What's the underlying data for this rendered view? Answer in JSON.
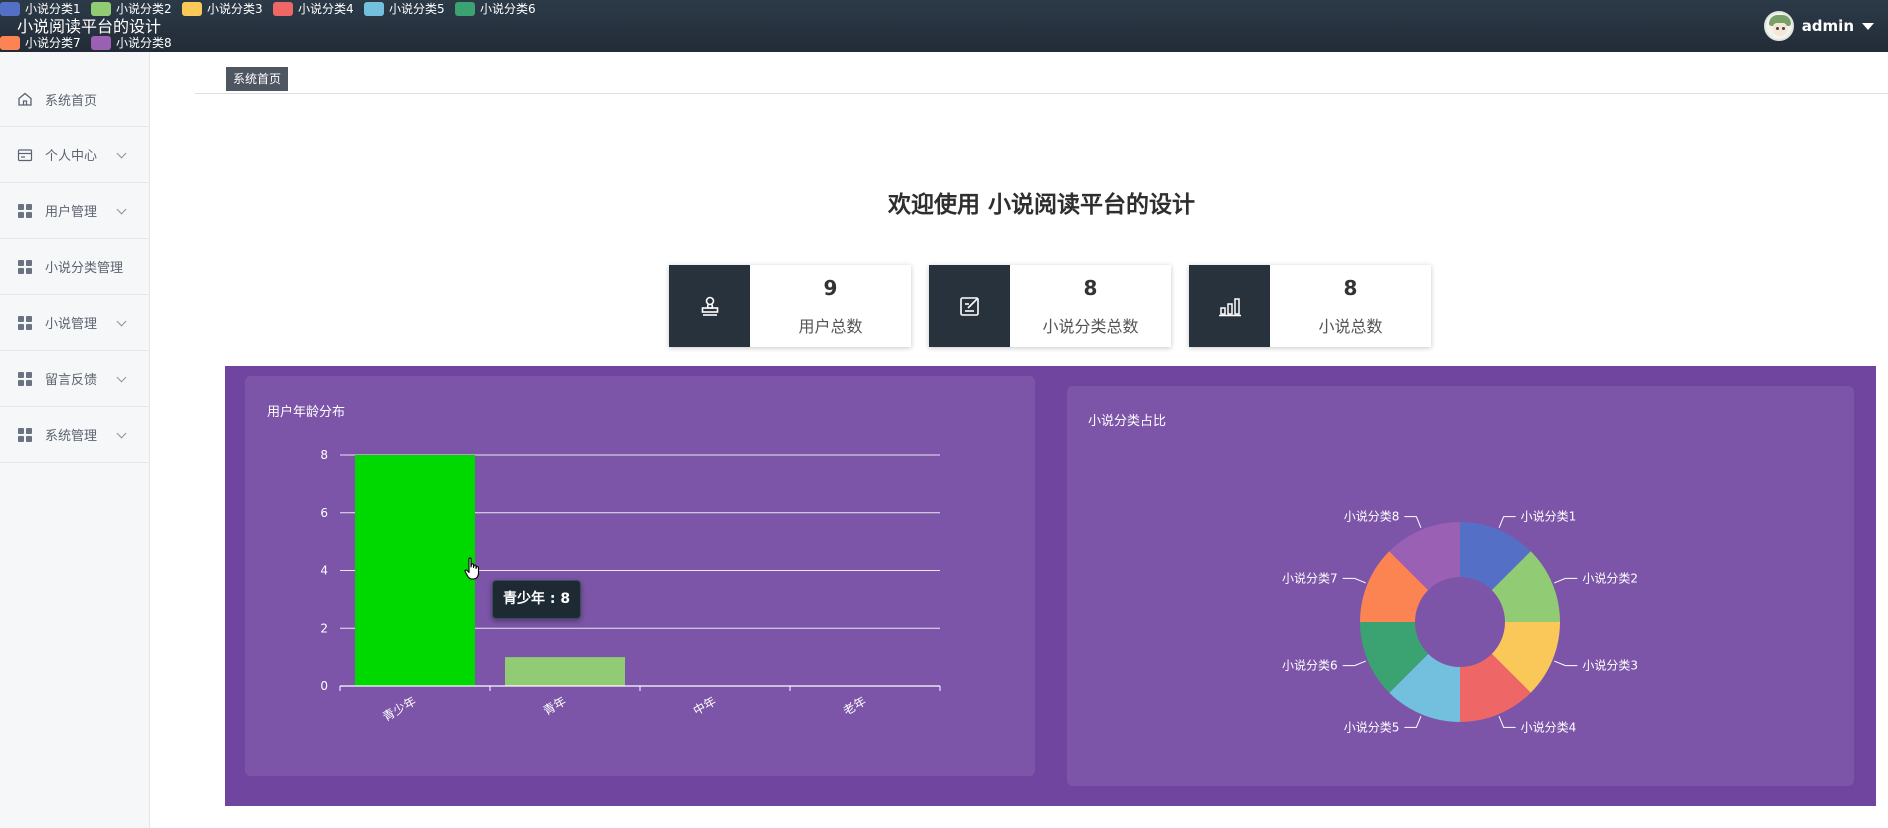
{
  "app": {
    "title": "小说阅读平台的设计"
  },
  "user": {
    "name": "admin"
  },
  "sidebar": {
    "items": [
      {
        "label": "系统首页",
        "icon": "home-icon",
        "expandable": false
      },
      {
        "label": "个人中心",
        "icon": "card-icon",
        "expandable": true
      },
      {
        "label": "用户管理",
        "icon": "grid-icon",
        "expandable": true
      },
      {
        "label": "小说分类管理",
        "icon": "grid-icon",
        "expandable": false
      },
      {
        "label": "小说管理",
        "icon": "grid-icon",
        "expandable": true
      },
      {
        "label": "留言反馈",
        "icon": "grid-icon",
        "expandable": true
      },
      {
        "label": "系统管理",
        "icon": "grid-icon",
        "expandable": true
      }
    ]
  },
  "breadcrumb": {
    "current": "系统首页"
  },
  "welcome": {
    "text": "欢迎使用 小说阅读平台的设计"
  },
  "stats": [
    {
      "value": "9",
      "label": "用户总数",
      "icon": "stamp-icon"
    },
    {
      "value": "8",
      "label": "小说分类总数",
      "icon": "edit-icon"
    },
    {
      "value": "8",
      "label": "小说总数",
      "icon": "bar-chart-icon"
    }
  ],
  "tooltip": {
    "text": "青少年 : 8"
  },
  "colors": {
    "topbar": "#27323e",
    "chart_area": "#6f45a0",
    "panel": "#7c55a8",
    "bar_highlight": "#00d900",
    "bar_default": "#91cc75"
  },
  "chart_data": [
    {
      "type": "bar",
      "title": "用户年龄分布",
      "categories": [
        "青少年",
        "青年",
        "中年",
        "老年"
      ],
      "values": [
        8,
        1,
        0,
        0
      ],
      "ylim": [
        0,
        8
      ],
      "yticks": [
        0,
        2,
        4,
        6,
        8
      ],
      "grid": true,
      "highlighted_category": "青少年"
    },
    {
      "type": "pie",
      "title": "小说分类占比",
      "donut": true,
      "legend_position": "top-right",
      "labels": [
        "小说分类1",
        "小说分类2",
        "小说分类3",
        "小说分类4",
        "小说分类5",
        "小说分类6",
        "小说分类7",
        "小说分类8"
      ],
      "values": [
        1,
        1,
        1,
        1,
        1,
        1,
        1,
        1
      ],
      "colors": [
        "#5470c6",
        "#91cc75",
        "#fac858",
        "#ee6666",
        "#73c0de",
        "#3ba272",
        "#fc8452",
        "#9a60b4"
      ]
    }
  ]
}
